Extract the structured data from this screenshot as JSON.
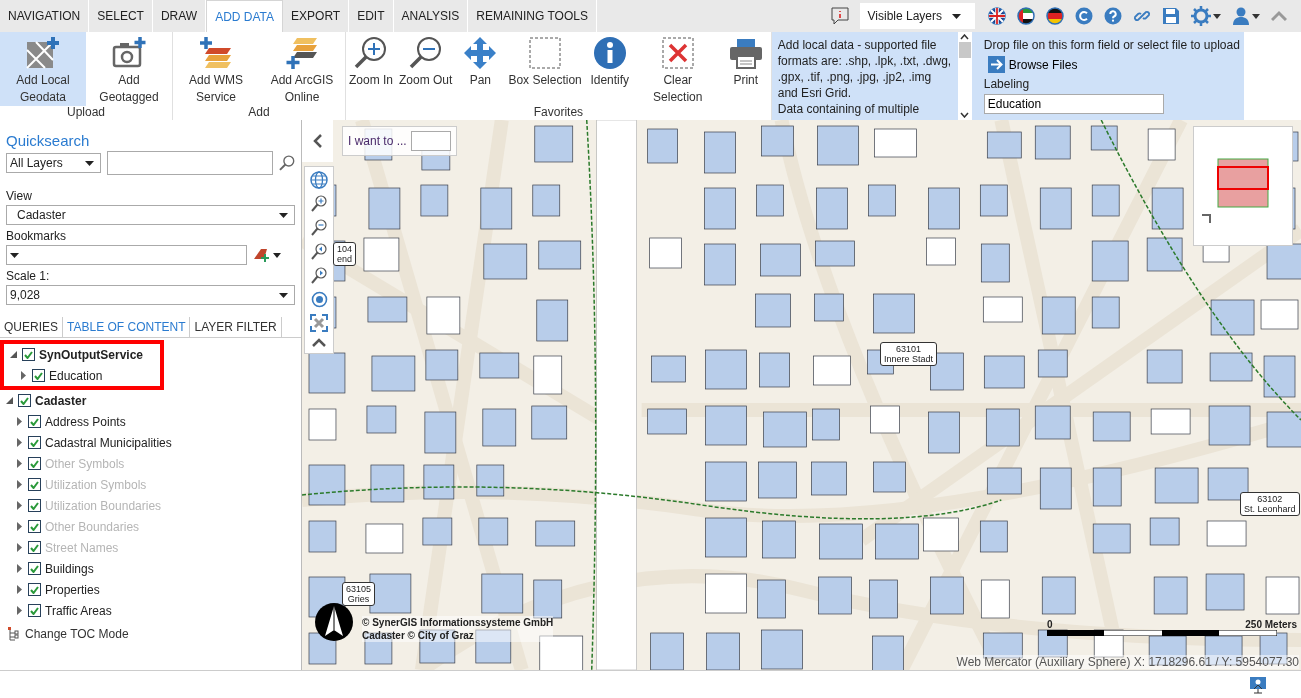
{
  "tabs": [
    {
      "label": "NAVIGATION",
      "selected": false
    },
    {
      "label": "SELECT",
      "selected": false
    },
    {
      "label": "DRAW",
      "selected": false
    },
    {
      "label": "ADD DATA",
      "selected": true
    },
    {
      "label": "EXPORT",
      "selected": false
    },
    {
      "label": "EDIT",
      "selected": false
    },
    {
      "label": "ANALYSIS",
      "selected": false
    },
    {
      "label": "REMAINING TOOLS",
      "selected": false
    }
  ],
  "header_tools": {
    "layer_dropdown": "Visible Layers"
  },
  "ribbon": {
    "groups": [
      {
        "label": "Upload",
        "buttons": [
          {
            "label": "Add Local Geodata",
            "kind": "geodata",
            "selected": true
          },
          {
            "label": "Add Geotagged",
            "kind": "camera",
            "selected": false
          }
        ]
      },
      {
        "label": "Add",
        "buttons": [
          {
            "label": "Add WMS Service",
            "kind": "wms",
            "selected": false
          },
          {
            "label": "Add ArcGIS Online",
            "kind": "arcgis",
            "selected": false
          }
        ]
      },
      {
        "label": "Favorites",
        "buttons": [
          {
            "label": "Zoom In",
            "kind": "zoomin",
            "selected": false
          },
          {
            "label": "Zoom Out",
            "kind": "zoomout",
            "selected": false
          },
          {
            "label": "Pan",
            "kind": "pan",
            "selected": false
          },
          {
            "label": "Box Selection",
            "kind": "box",
            "selected": false
          },
          {
            "label": "Identify",
            "kind": "identify",
            "selected": false
          },
          {
            "label": "Clear Selection",
            "kind": "clear",
            "selected": false
          },
          {
            "label": "Print",
            "kind": "print",
            "selected": false
          }
        ]
      }
    ]
  },
  "upload_panel": {
    "description": [
      "Add local data - supported file formats are: .shp, .lpk, .txt, .dwg, .gpx, .tif, .png, .jpg, .jp2, .img and Esri Grid.",
      "Data containing of multiple"
    ],
    "drop_hint": "Drop file on this form field or select file to upload",
    "browse_button": "Browse Files",
    "labeling_label": "Labeling",
    "labeling_value": "Education"
  },
  "sidebar": {
    "quicksearch_title": "Quicksearch",
    "search_scope": "All Layers",
    "view_label": "View",
    "view_value": "Cadaster",
    "bookmarks_label": "Bookmarks",
    "scale_label": "Scale 1:",
    "scale_value": "9,028",
    "tabs": [
      {
        "label": "QUERIES",
        "selected": false
      },
      {
        "label": "TABLE OF CONTENT",
        "selected": true
      },
      {
        "label": "LAYER FILTER",
        "selected": false
      }
    ],
    "tree": [
      {
        "label": "SynOutputService",
        "checked": true,
        "expanded": true,
        "disabled": false,
        "highlighted": true,
        "children": [
          {
            "label": "Education",
            "checked": true,
            "expanded": false,
            "disabled": false
          }
        ]
      },
      {
        "label": "Cadaster",
        "checked": true,
        "expanded": true,
        "disabled": false,
        "highlighted": false,
        "children": [
          {
            "label": "Address Points",
            "checked": true,
            "expanded": false,
            "disabled": false
          },
          {
            "label": "Cadastral Municipalities",
            "checked": true,
            "expanded": false,
            "disabled": false
          },
          {
            "label": "Other Symbols",
            "checked": true,
            "expanded": false,
            "disabled": true
          },
          {
            "label": "Utilization Symbols",
            "checked": true,
            "expanded": false,
            "disabled": true
          },
          {
            "label": "Utilization Boundaries",
            "checked": true,
            "expanded": false,
            "disabled": true
          },
          {
            "label": "Other Boundaries",
            "checked": true,
            "expanded": false,
            "disabled": true
          },
          {
            "label": "Street Names",
            "checked": true,
            "expanded": false,
            "disabled": true
          },
          {
            "label": "Buildings",
            "checked": true,
            "expanded": false,
            "disabled": false
          },
          {
            "label": "Properties",
            "checked": true,
            "expanded": false,
            "disabled": false
          },
          {
            "label": "Traffic Areas",
            "checked": true,
            "expanded": false,
            "disabled": false
          }
        ]
      }
    ],
    "toc_mode_link": "Change TOC Mode"
  },
  "map": {
    "i_want_to": "I want to ...",
    "district_labels": [
      {
        "code": "104",
        "name": "end"
      },
      {
        "code": "63101",
        "name": "Innere Stadt"
      },
      {
        "code": "63102",
        "name": "St. Leonhard"
      },
      {
        "code": "63105",
        "name": "Gries"
      }
    ],
    "copyright": [
      "© SynerGIS Informationssysteme GmbH",
      "Cadaster © City of Graz"
    ],
    "scale_start": "0",
    "scale_end": "250 Meters",
    "coordinates": "Web Mercator (Auxiliary Sphere) X: 1718296.61 / Y: 5954077.30"
  }
}
